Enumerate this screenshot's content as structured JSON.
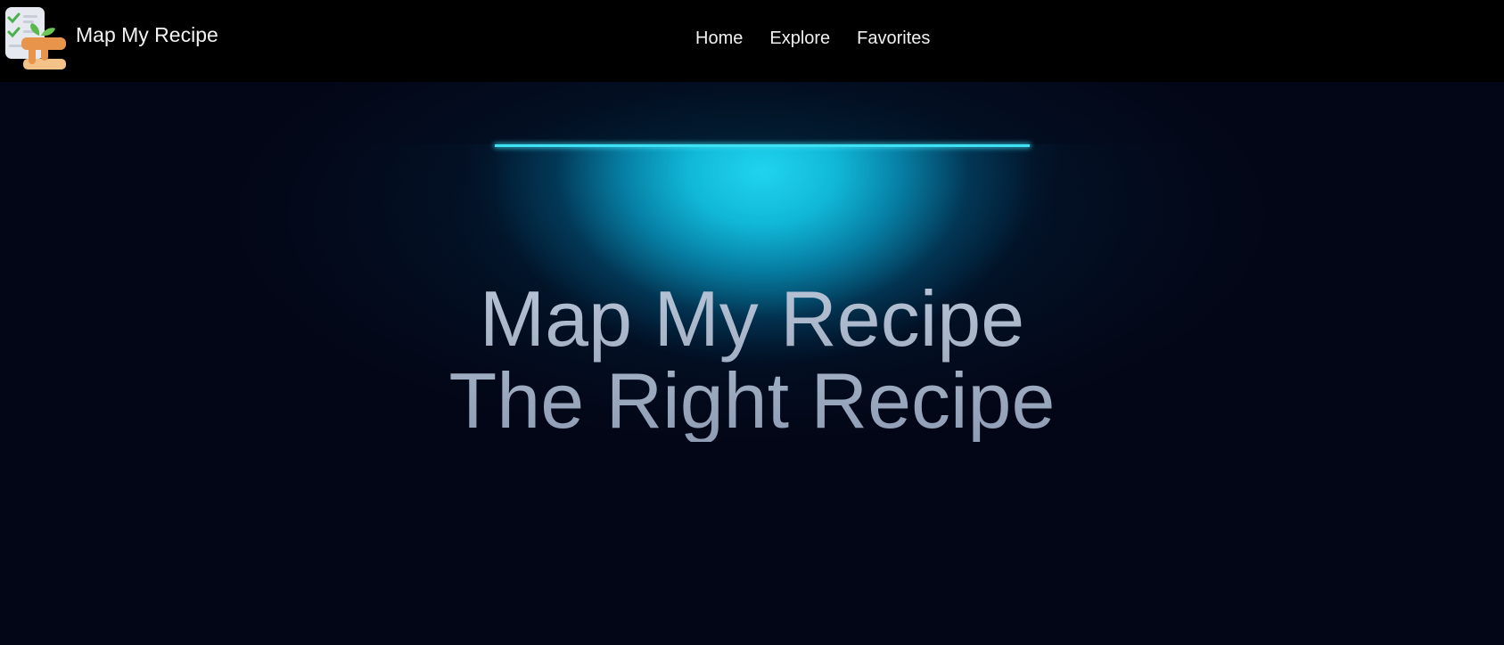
{
  "navbar": {
    "brand_name": "Map My Recipe",
    "links": [
      {
        "label": "Home"
      },
      {
        "label": "Explore"
      },
      {
        "label": "Favorites"
      }
    ]
  },
  "hero": {
    "line1": "Map My Recipe",
    "line2": "The Right Recipe"
  },
  "colors": {
    "nav_background": "#000000",
    "page_background": "#030616",
    "glow_accent": "#20d4ee",
    "headline_text": "#9fadc2"
  }
}
